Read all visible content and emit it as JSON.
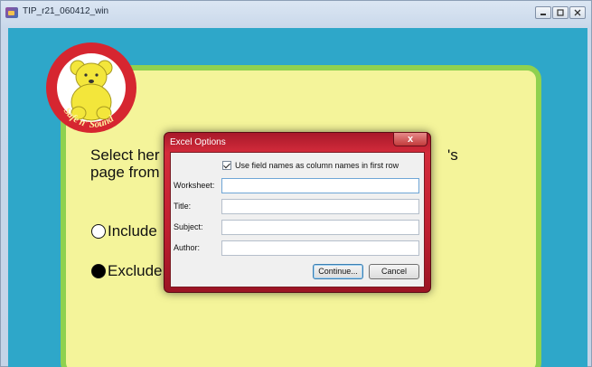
{
  "window": {
    "title": "TIP_r21_060412_win"
  },
  "logo": {
    "text": "Safe n' Sound",
    "colors": {
      "ring": "#d62630",
      "bear": "#f3e63b",
      "fill": "#ffffff"
    }
  },
  "prompt": {
    "line1": "Select her",
    "line2": "page from",
    "tail": "'s"
  },
  "options": [
    {
      "label": "Include",
      "selected": false
    },
    {
      "label": "Exclude",
      "selected": true
    }
  ],
  "dialog": {
    "title": "Excel Options",
    "close_label": "x",
    "checkbox": {
      "label": "Use field names as column names in first row",
      "checked": true
    },
    "fields": [
      {
        "label": "Worksheet:",
        "value": ""
      },
      {
        "label": "Title:",
        "value": ""
      },
      {
        "label": "Subject:",
        "value": ""
      },
      {
        "label": "Author:",
        "value": ""
      }
    ],
    "continue_label": "Continue...",
    "cancel_label": "Cancel"
  },
  "colors": {
    "background": "#2ea7c9",
    "panel": "#f4f49a",
    "panel_border": "#8fd14f",
    "dialog_frame": "#c01f30"
  }
}
